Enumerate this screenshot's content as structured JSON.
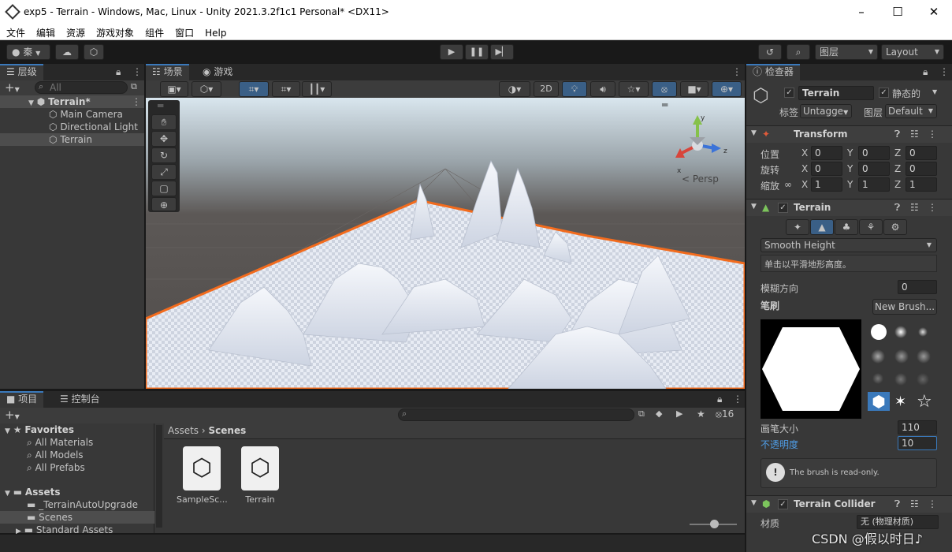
{
  "window": {
    "title": "exp5 - Terrain - Windows, Mac, Linux - Unity 2021.3.2f1c1 Personal* <DX11>"
  },
  "menu": [
    "文件",
    "编辑",
    "资源",
    "游戏对象",
    "组件",
    "窗口",
    "Help"
  ],
  "toolbar": {
    "account": "秦",
    "layers": "图层",
    "layout": "Layout"
  },
  "hierarchy": {
    "tab": "层级",
    "search_placeholder": "All",
    "scene": "Terrain*",
    "items": [
      "Main Camera",
      "Directional Light",
      "Terrain"
    ]
  },
  "scene_view": {
    "tab_scene": "场景",
    "tab_game": "游戏",
    "mode_2d": "2D",
    "persp": "Persp",
    "axis_x": "x",
    "axis_z": "z",
    "axis_y": "y"
  },
  "project": {
    "tab_project": "项目",
    "tab_console": "控制台",
    "hidden_count": "16",
    "favorites": {
      "label": "Favorites",
      "items": [
        "All Materials",
        "All Models",
        "All Prefabs"
      ]
    },
    "assets": {
      "label": "Assets",
      "items": [
        "_TerrainAutoUpgrade",
        "Scenes",
        "Standard Assets"
      ]
    },
    "breadcrumb": [
      "Assets",
      "Scenes"
    ],
    "files": [
      "SampleSc...",
      "Terrain"
    ]
  },
  "inspector": {
    "tab": "检查器",
    "object_name": "Terrain",
    "static_label": "静态的",
    "tag_label": "标签",
    "tag_value": "Untagge",
    "layer_label": "图层",
    "layer_value": "Default",
    "transform": {
      "title": "Transform",
      "rows": [
        {
          "label": "位置",
          "x": "0",
          "y": "0",
          "z": "0"
        },
        {
          "label": "旋转",
          "x": "0",
          "y": "0",
          "z": "0"
        },
        {
          "label": "缩放",
          "x": "1",
          "y": "1",
          "z": "1"
        }
      ]
    },
    "terrain": {
      "title": "Terrain",
      "tool": "Smooth Height",
      "tool_desc": "单击以平滑地形高度。",
      "blur_label": "模糊方向",
      "blur_value": "0",
      "brush_label": "笔刷",
      "new_brush": "New Brush...",
      "brush_size_label": "画笔大小",
      "brush_size": "110",
      "opacity_label": "不透明度",
      "opacity": "10",
      "readonly_msg": "The brush is read-only."
    },
    "collider": {
      "title": "Terrain Collider",
      "material_label": "材质",
      "material_value": "无 (物理材质)"
    }
  },
  "watermark": "CSDN @假以时日♪",
  "colors": {
    "accent": "#3a79bb",
    "selection": "#2c5d87",
    "terrain_outline": "#f26b1d"
  }
}
